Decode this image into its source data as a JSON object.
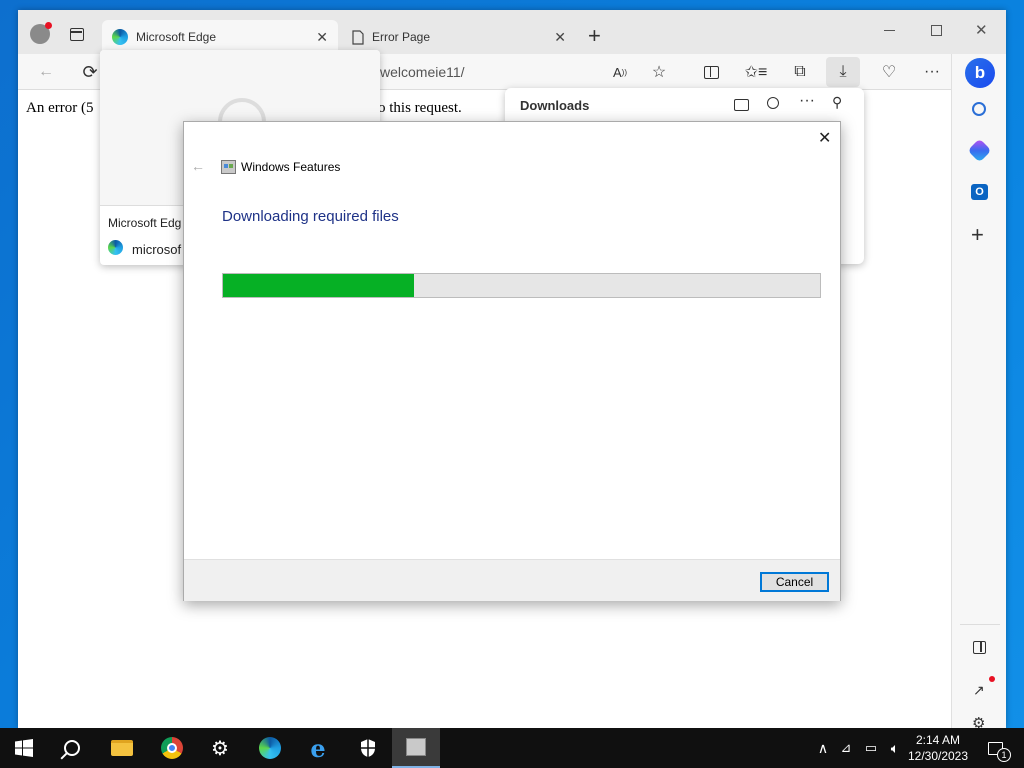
{
  "browser": {
    "tabs": [
      {
        "title": "Microsoft Edge",
        "active": true
      },
      {
        "title": "Error Page",
        "active": false
      }
    ],
    "address_fragment": "welcomeie11/",
    "page_error_left": "An error (5",
    "page_error_right": "o this request."
  },
  "hover_card": {
    "title": "Microsoft Edg",
    "url": "microsof"
  },
  "downloads_panel": {
    "title": "Downloads"
  },
  "dialog": {
    "app_title": "Windows Features",
    "heading": "Downloading required files",
    "progress_fraction": 0.32,
    "cancel_label": "Cancel",
    "colors": {
      "progress": "#06b025",
      "heading": "#1e3287"
    }
  },
  "taskbar": {
    "time": "2:14 AM",
    "date": "12/30/2023",
    "notification_count": "1"
  }
}
